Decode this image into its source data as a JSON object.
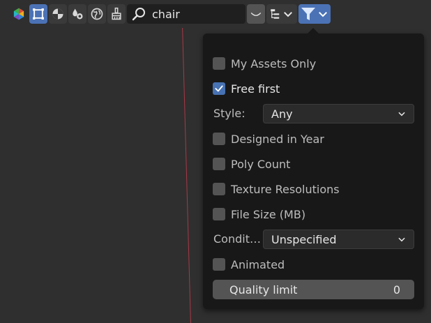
{
  "toolbar": {
    "icons": [
      "asset-library-logo-icon",
      "select-box-icon",
      "shading-icon",
      "drops-icon",
      "globe-icon",
      "brush-icon"
    ],
    "search": {
      "value": "chair",
      "icon": "magnifier-icon"
    },
    "buttons": [
      "display-shape-icon",
      "hierarchy-icon",
      "filter-icon"
    ]
  },
  "popup": {
    "my_assets_only": {
      "label": "My Assets Only",
      "checked": false
    },
    "free_first": {
      "label": "Free first",
      "checked": true
    },
    "style": {
      "label": "Style:",
      "value": "Any"
    },
    "designed_in_year": {
      "label": "Designed in Year",
      "checked": false
    },
    "poly_count": {
      "label": "Poly Count",
      "checked": false
    },
    "texture_resolutions": {
      "label": "Texture Resolutions",
      "checked": false
    },
    "file_size": {
      "label": "File Size (MB)",
      "checked": false
    },
    "condition": {
      "label": "Condit…",
      "value": "Unspecified"
    },
    "animated": {
      "label": "Animated",
      "checked": false
    },
    "quality_limit": {
      "label": "Quality limit",
      "value": "0"
    }
  },
  "colors": {
    "background": "#2f2f2f",
    "popup": "#181818",
    "accent": "#4b72b5",
    "red_line": "#b83a4a"
  }
}
